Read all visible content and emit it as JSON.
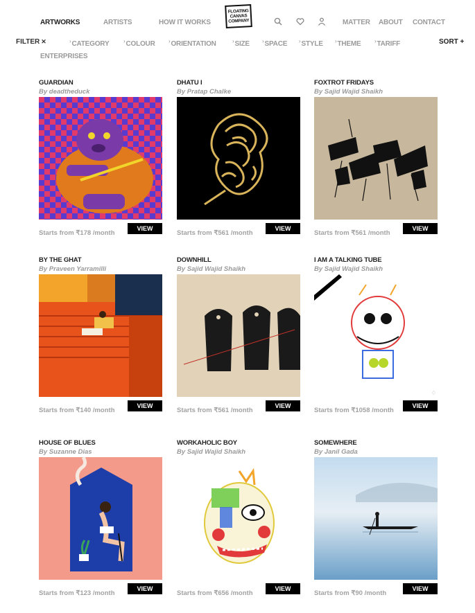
{
  "nav": {
    "artworks": "ARTWORKS",
    "artists": "ARTISTS",
    "how_it_works": "HOW IT WORKS",
    "logo_lines": [
      "FLOATING",
      "CANVAS",
      "COMPANY"
    ],
    "matter": "MATTER",
    "about": "ABOUT",
    "contact": "CONTACT",
    "icons": [
      "search-icon",
      "heart-icon",
      "user-icon"
    ]
  },
  "filters": {
    "filter_label": "FILTER",
    "filter_close": "✕",
    "items": [
      "CATEGORY",
      "COLOUR",
      "ORIENTATION",
      "SIZE",
      "SPACE",
      "STYLE",
      "THEME",
      "TARIFF",
      "ENTERPRISES"
    ],
    "sort_label": "SORT +"
  },
  "view_label": "VIEW",
  "artworks": [
    {
      "title": "GUARDIAN",
      "artist": "By deadtheduck",
      "price": "Starts from ₹178 /month"
    },
    {
      "title": "DHATU I",
      "artist": "By Pratap Chalke",
      "price": "Starts from ₹561 /month"
    },
    {
      "title": "FOXTROT FRIDAYS",
      "artist": "By Sajid Wajid Shaikh",
      "price": "Starts from ₹561 /month"
    },
    {
      "title": "BY THE GHAT",
      "artist": "By Praveen Yarramilli",
      "price": "Starts from ₹140 /month"
    },
    {
      "title": "DOWNHILL",
      "artist": "By Sajid Wajid Shaikh",
      "price": "Starts from ₹561 /month"
    },
    {
      "title": "I AM A TALKING TUBE",
      "artist": "By Sajid Wajid Shaikh",
      "price": "Starts from ₹1058 /month"
    },
    {
      "title": "HOUSE OF BLUES",
      "artist": "By Suzanne Dias",
      "price": "Starts from ₹123 /month"
    },
    {
      "title": "WORKAHOLIC BOY",
      "artist": "By Sajid Wajid Shaikh",
      "price": "Starts from ₹656 /month"
    },
    {
      "title": "SOMEWHERE",
      "artist": "By Janil Gada",
      "price": "Starts from ₹90 /month"
    }
  ]
}
